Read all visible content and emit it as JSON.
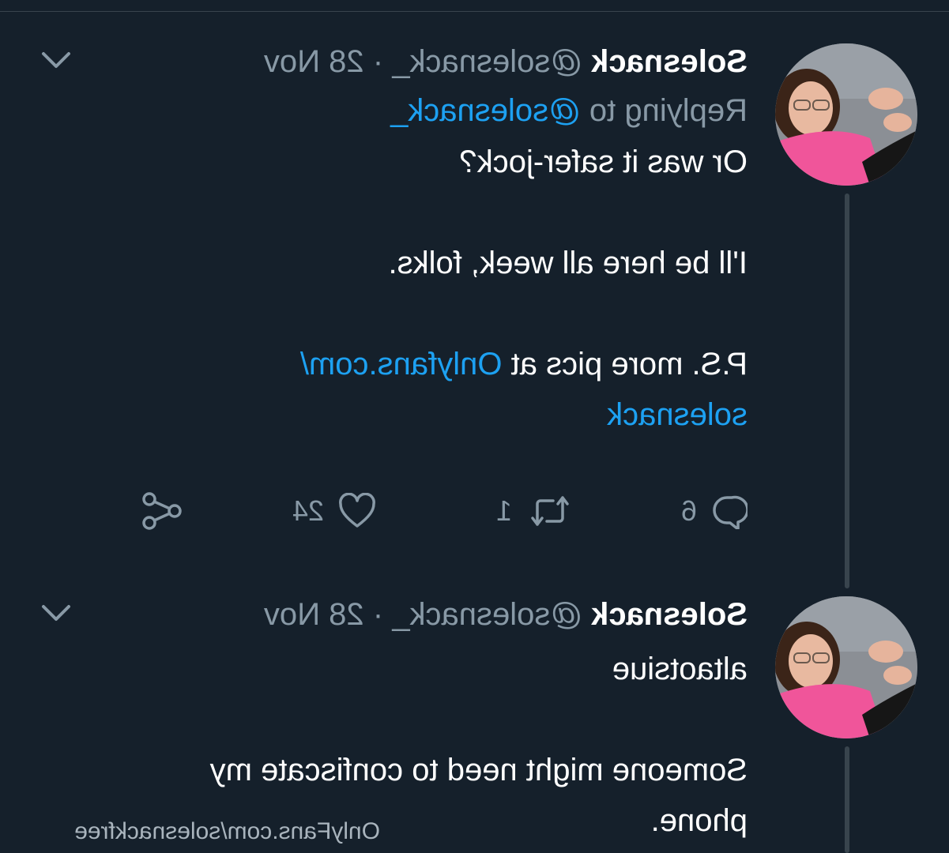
{
  "colors": {
    "background": "#15202b",
    "text": "#ffffff",
    "muted": "#8899a6",
    "link": "#1da1f2",
    "divider": "#38444d"
  },
  "tweets": [
    {
      "display_name": "Solesnack",
      "handle": "@solesnack_",
      "separator": "·",
      "date": "28 Nov",
      "replying_prefix": "Replying to",
      "replying_to": "@solesnack_",
      "paragraphs": [
        "Or was it safer-jock?",
        "I'll be here all week, folks."
      ],
      "ps_text": "P.S. more pics at",
      "ps_link_line1": "Onlyfans.com/",
      "ps_link_line2": "solesnack",
      "actions": {
        "reply_count": "6",
        "retweet_count": "1",
        "like_count": "24"
      },
      "icons": [
        "reply-icon",
        "retweet-icon",
        "like-icon",
        "share-icon",
        "chevron-down-icon"
      ]
    },
    {
      "display_name": "Solesnack",
      "handle": "@solesnack_",
      "separator": "·",
      "date": "28 Nov",
      "first_line": "altaotsiue",
      "body_line1": "Someone might need to confiscate my",
      "body_line2": "phone.",
      "icons": [
        "chevron-down-icon"
      ]
    }
  ],
  "watermark": "OnlyFans.com/solesnackfree"
}
